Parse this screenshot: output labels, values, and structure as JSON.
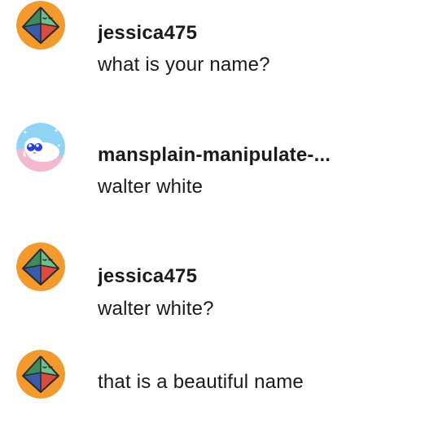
{
  "messages": [
    {
      "author": "jessica475",
      "text": "what is your name?",
      "avatar": "octahedron-icon",
      "show_header": true
    },
    {
      "author": "mansplain-manipulate-...",
      "text": "walter white",
      "avatar": "white-creature-avatar",
      "show_header": true
    },
    {
      "author": "jessica475",
      "text": "walter white?",
      "avatar": "octahedron-icon",
      "show_header": true
    },
    {
      "author": "",
      "text": "that is a beautiful name",
      "avatar": "octahedron-icon",
      "show_header": false
    }
  ],
  "colors": {
    "user_avatar_bg": "#F29A2E",
    "bot_avatar_bg": "#8FD3F5",
    "text": "#1a1a1a"
  }
}
